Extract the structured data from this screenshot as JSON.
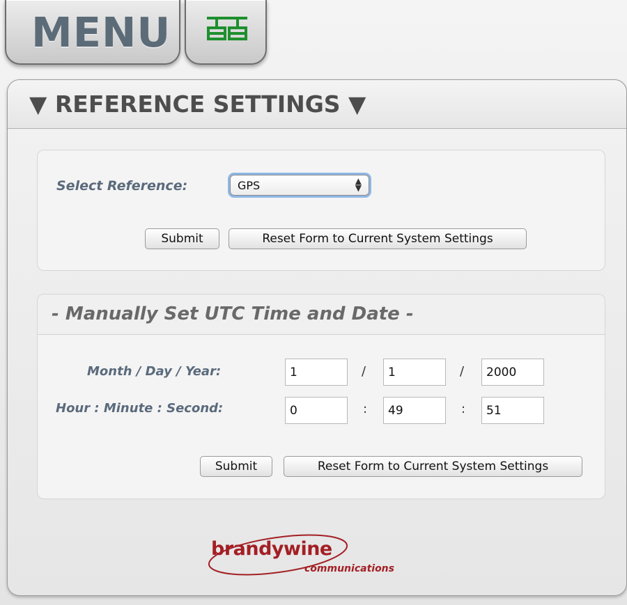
{
  "tabs": {
    "menu_label": "MENU",
    "network_icon": "network-topology-icon"
  },
  "panel": {
    "title": "▼ REFERENCE SETTINGS ▼"
  },
  "reference_form": {
    "select_label": "Select Reference:",
    "selected_value": "GPS",
    "submit_label": "Submit",
    "reset_label": "Reset Form to Current System Settings"
  },
  "time_form": {
    "title": "- Manually Set UTC Time and Date -",
    "date_label": "Month / Day / Year:",
    "time_label": "Hour : Minute : Second:",
    "month": "1",
    "day": "1",
    "year": "2000",
    "hour": "0",
    "minute": "49",
    "second": "51",
    "date_separator": "/",
    "time_separator": ":",
    "submit_label": "Submit",
    "reset_label": "Reset Form to Current System Settings"
  },
  "logo": {
    "text_main": "brandywine",
    "text_sub": "communications"
  },
  "colors": {
    "logo_red": "#a31f24",
    "label_blue_gray": "#5a6a7c",
    "icon_green": "#1e8f2e",
    "focus_ring": "#8fb7e6"
  }
}
